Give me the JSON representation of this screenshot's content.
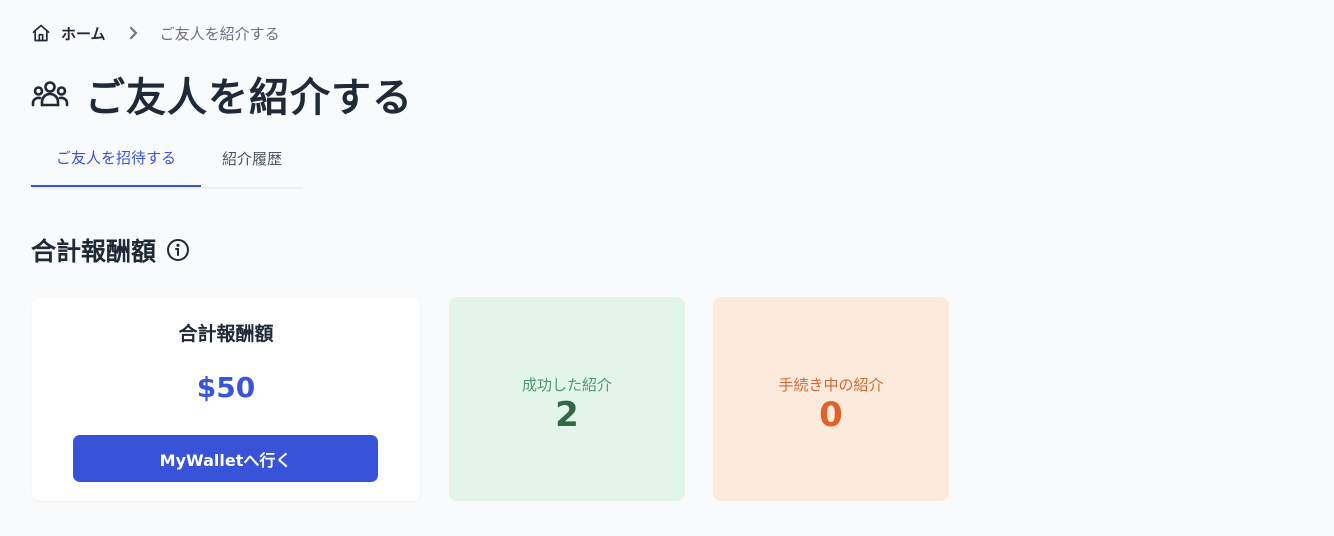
{
  "breadcrumb": {
    "home_label": "ホーム",
    "current_label": "ご友人を紹介する"
  },
  "page": {
    "title": "ご友人を紹介する"
  },
  "tabs": [
    {
      "label": "ご友人を招待する",
      "active": true
    },
    {
      "label": "紹介履歴",
      "active": false
    }
  ],
  "rewards": {
    "section_title": "合計報酬額",
    "total_card": {
      "label": "合計報酬額",
      "amount": "$50",
      "button_label": "MyWalletへ行く"
    },
    "success_card": {
      "label": "成功した紹介",
      "value": "2"
    },
    "pending_card": {
      "label": "手続き中の紹介",
      "value": "0"
    }
  },
  "colors": {
    "accent": "#3b55d9",
    "success_bg": "#e3f5ea",
    "success_text": "#2f6a45",
    "pending_bg": "#fcebdd",
    "pending_text": "#e0622a"
  },
  "icons": {
    "home": "home-icon",
    "separator": "chevron-right-icon",
    "title": "users-group-icon",
    "info": "info-circle-icon"
  }
}
